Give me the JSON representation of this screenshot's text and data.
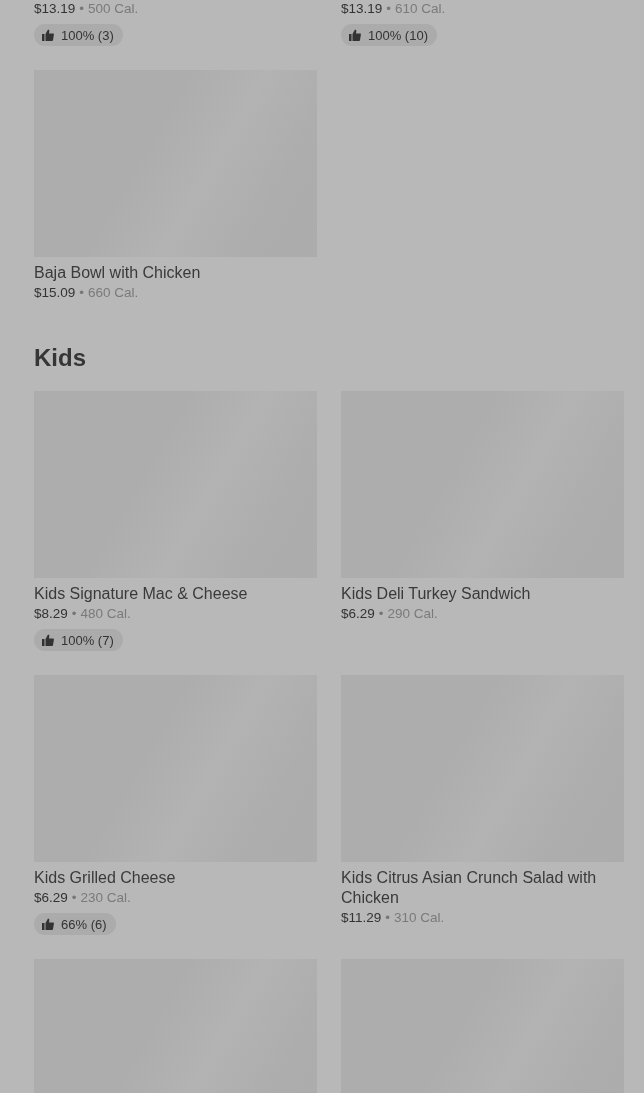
{
  "sections": [
    {
      "items": [
        {
          "image": false,
          "price": "$13.19",
          "separator": "•",
          "calories": "500 Cal.",
          "rating": "100% (3)"
        },
        {
          "image": false,
          "price": "$13.19",
          "separator": "•",
          "calories": "610 Cal.",
          "rating": "100% (10)"
        },
        {
          "image": true,
          "name": "Baja Bowl with Chicken",
          "price": "$15.09",
          "separator": "•",
          "calories": "660 Cal."
        }
      ]
    },
    {
      "title": "Kids",
      "items": [
        {
          "image": true,
          "name": "Kids Signature Mac & Cheese",
          "price": "$8.29",
          "separator": "•",
          "calories": "480 Cal.",
          "rating": "100% (7)"
        },
        {
          "image": true,
          "name": "Kids Deli Turkey Sandwich",
          "price": "$6.29",
          "separator": "•",
          "calories": "290 Cal."
        },
        {
          "image": true,
          "name": "Kids Grilled Cheese",
          "price": "$6.29",
          "separator": "•",
          "calories": "230 Cal.",
          "rating": "66% (6)"
        },
        {
          "image": true,
          "name": "Kids Citrus Asian Crunch Salad with Chicken",
          "price": "$11.29",
          "separator": "•",
          "calories": "310 Cal."
        },
        {
          "image": true
        },
        {
          "image": true
        }
      ]
    }
  ]
}
